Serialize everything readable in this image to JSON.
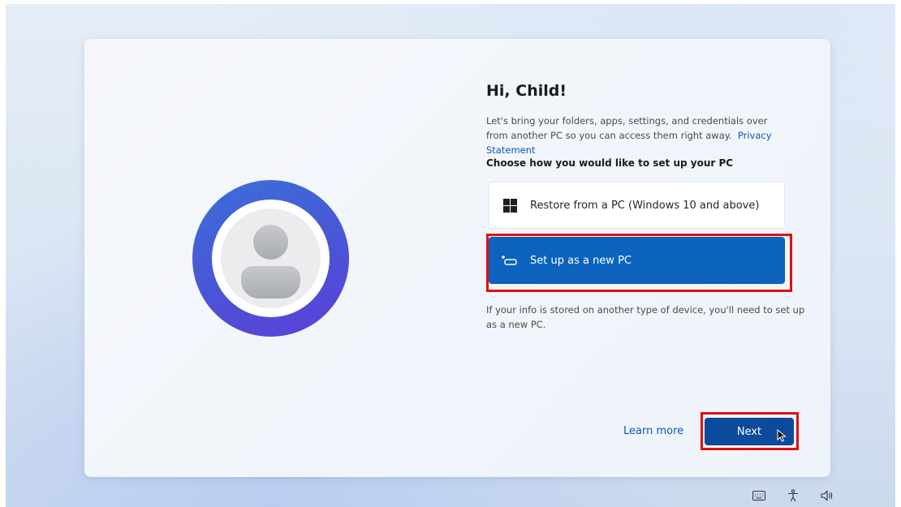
{
  "oobe": {
    "greeting": "Hi, Child!",
    "intro_text": "Let's bring your folders, apps, settings, and credentials over from another PC so you can access them right away.",
    "privacy_link": "Privacy Statement",
    "choose_heading": "Choose how you would like to set up your PC",
    "options": [
      {
        "label": "Restore from a PC (Windows 10 and above)",
        "icon": "windows-logo-icon",
        "selected": false
      },
      {
        "label": "Set up as a new PC",
        "icon": "new-pc-icon",
        "selected": true
      }
    ],
    "note_text": "If your info is stored on another type of device, you'll need to set up as a new PC.",
    "learn_more": "Learn more",
    "next_label": "Next"
  },
  "tray": {
    "icons": [
      "keyboard-icon",
      "accessibility-icon",
      "volume-icon"
    ]
  },
  "colors": {
    "accent": "#0b63bd",
    "next_button": "#0c4a9c",
    "link": "#0b57b6",
    "highlight": "#e01010"
  }
}
